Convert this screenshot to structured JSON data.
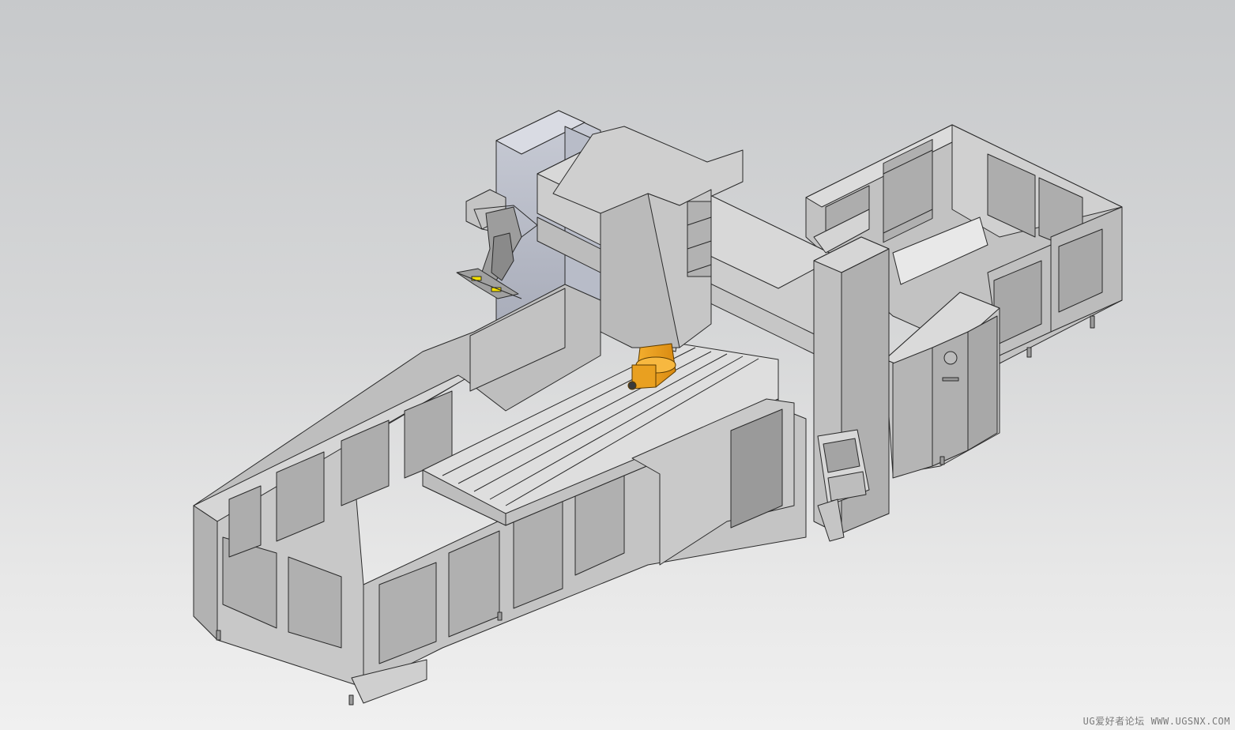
{
  "viewport": {
    "background_top": "#c7c9cb",
    "background_bottom": "#f0f0f0",
    "model_face_color": "#c8c8c8",
    "model_edge_color": "#2a2a2a",
    "spindle_color": "#f0a020",
    "accent_yellow": "#f5e000"
  },
  "watermark": {
    "forum_name": "UG爱好者论坛",
    "site_url": "WWW.UGSNX.COM"
  }
}
